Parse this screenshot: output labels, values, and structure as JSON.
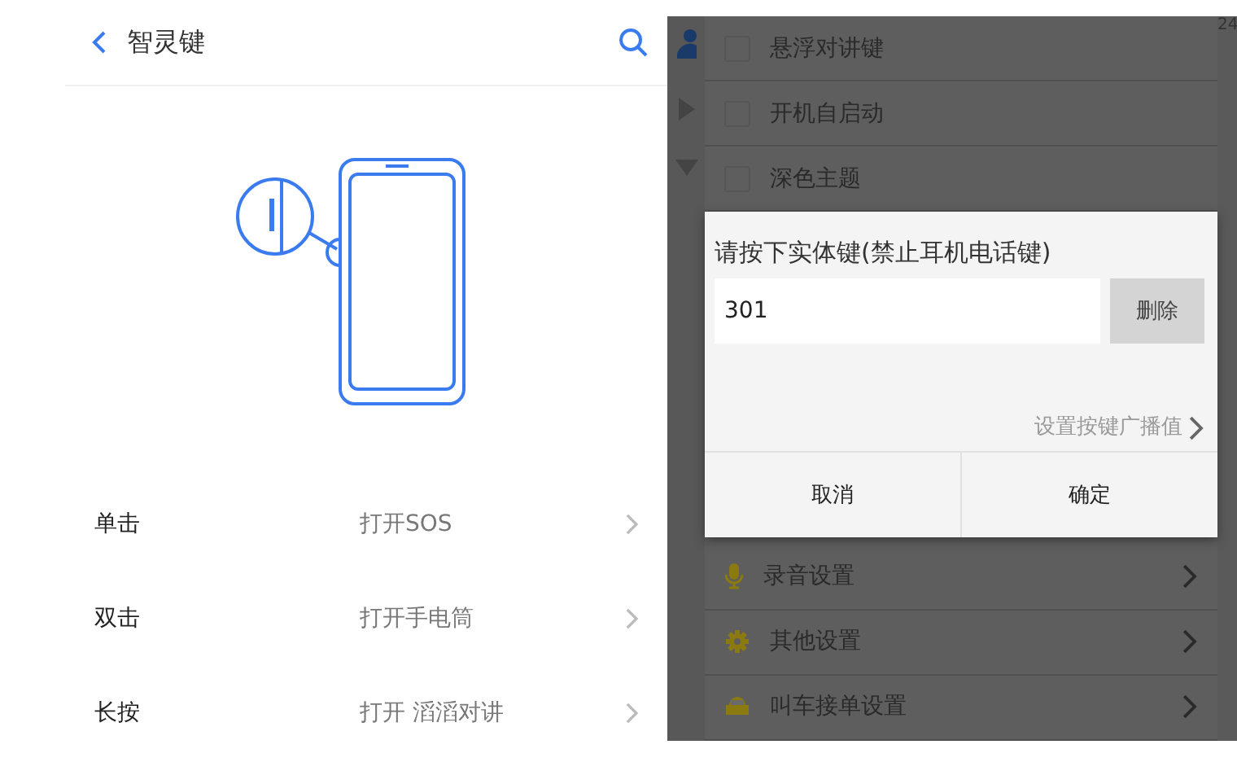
{
  "left_screen": {
    "header": {
      "title": "智灵键"
    },
    "actions": [
      {
        "label": "单击",
        "value": "打开SOS"
      },
      {
        "label": "双击",
        "value": "打开手电筒"
      },
      {
        "label": "长按",
        "value": "打开 滔滔对讲"
      }
    ]
  },
  "right_screen": {
    "corner_text": "24",
    "options": [
      {
        "label": "悬浮对讲键",
        "checked": false
      },
      {
        "label": "开机自启动",
        "checked": false
      },
      {
        "label": "深色主题",
        "checked": false
      }
    ],
    "settings": [
      {
        "label": "录音设置",
        "kind": "mic"
      },
      {
        "label": "其他设置",
        "kind": "gear"
      },
      {
        "label": "叫车接单设置",
        "kind": "car"
      }
    ],
    "dialog": {
      "title": "请按下实体键(禁止耳机电话键)",
      "value": "301",
      "delete_button": "删除",
      "link": "设置按键广播值",
      "buttons": [
        "取消",
        "确定"
      ]
    }
  }
}
